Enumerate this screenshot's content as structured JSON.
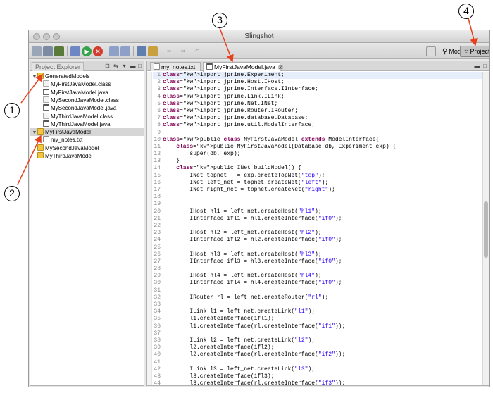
{
  "window": {
    "title": "Slingshot"
  },
  "perspectives": [
    {
      "label": "Model",
      "active": false
    },
    {
      "label": "Project",
      "active": true
    }
  ],
  "explorer": {
    "tab_label": "Project Explorer",
    "tree": [
      {
        "label": "GeneratedModels",
        "icon": "folder-icon",
        "expanded": true,
        "indent": 0
      },
      {
        "label": "MyFirstJavaModel.class",
        "icon": "class-file-icon",
        "indent": 1
      },
      {
        "label": "MyFirstJavaModel.java",
        "icon": "java-file-icon",
        "indent": 1
      },
      {
        "label": "MySecondJavaModel.class",
        "icon": "class-file-icon",
        "indent": 1
      },
      {
        "label": "MySecondJavaModel.java",
        "icon": "java-file-icon",
        "indent": 1
      },
      {
        "label": "MyThirdJavaModel.class",
        "icon": "class-file-icon",
        "indent": 1
      },
      {
        "label": "MyThirdJavaModel.java",
        "icon": "java-file-icon",
        "indent": 1
      },
      {
        "label": "MyFirstJavaModel",
        "icon": "folder-icon",
        "expanded": true,
        "indent": 0,
        "selected": true
      },
      {
        "label": "my_notes.txt",
        "icon": "text-file-icon",
        "indent": 1
      },
      {
        "label": "MySecondJavaModel",
        "icon": "folder-icon",
        "indent": 0
      },
      {
        "label": "MyThirdJavaModel",
        "icon": "folder-icon",
        "indent": 0
      }
    ]
  },
  "editor": {
    "tabs": [
      {
        "label": "my_notes.txt",
        "active": false
      },
      {
        "label": "MyFirstJavaModel.java",
        "active": true
      }
    ],
    "lines": [
      {
        "n": "1",
        "text": "import jprime.Experiment;"
      },
      {
        "n": "2",
        "text": "import jprime.Host.IHost;"
      },
      {
        "n": "3",
        "text": "import jprime.Interface.IInterface;"
      },
      {
        "n": "4",
        "text": "import jprime.Link.ILink;"
      },
      {
        "n": "5",
        "text": "import jprime.Net.INet;"
      },
      {
        "n": "6",
        "text": "import jprime.Router.IRouter;"
      },
      {
        "n": "7",
        "text": "import jprime.database.Database;"
      },
      {
        "n": "8",
        "text": "import jprime.util.ModelInterface;"
      },
      {
        "n": "9",
        "text": ""
      },
      {
        "n": "10",
        "text": "public class MyFirstJavaModel extends ModelInterface{"
      },
      {
        "n": "11",
        "text": "    public MyFirstJavaModel(Database db, Experiment exp) {"
      },
      {
        "n": "12",
        "text": "        super(db, exp);"
      },
      {
        "n": "13",
        "text": "    }"
      },
      {
        "n": "14",
        "text": "    public INet buildModel() {"
      },
      {
        "n": "15",
        "text": "        INet topnet   = exp.createTopNet(\"top\");"
      },
      {
        "n": "16",
        "text": "        INet left_net = topnet.createNet(\"left\");"
      },
      {
        "n": "17",
        "text": "        INet right_net = topnet.createNet(\"right\");"
      },
      {
        "n": "18",
        "text": ""
      },
      {
        "n": "19",
        "text": ""
      },
      {
        "n": "20",
        "text": "        IHost hl1 = left_net.createHost(\"hl1\");"
      },
      {
        "n": "21",
        "text": "        IInterface ifl1 = hl1.createInterface(\"if0\");"
      },
      {
        "n": "22",
        "text": ""
      },
      {
        "n": "23",
        "text": "        IHost hl2 = left_net.createHost(\"hl2\");"
      },
      {
        "n": "24",
        "text": "        IInterface ifl2 = hl2.createInterface(\"if0\");"
      },
      {
        "n": "25",
        "text": ""
      },
      {
        "n": "26",
        "text": "        IHost hl3 = left_net.createHost(\"hl3\");"
      },
      {
        "n": "27",
        "text": "        IInterface ifl3 = hl3.createInterface(\"if0\");"
      },
      {
        "n": "28",
        "text": ""
      },
      {
        "n": "29",
        "text": "        IHost hl4 = left_net.createHost(\"hl4\");"
      },
      {
        "n": "30",
        "text": "        IInterface ifl4 = hl4.createInterface(\"if0\");"
      },
      {
        "n": "31",
        "text": ""
      },
      {
        "n": "32",
        "text": "        IRouter rl = left_net.createRouter(\"rl\");"
      },
      {
        "n": "33",
        "text": ""
      },
      {
        "n": "34",
        "text": "        ILink l1 = left_net.createLink(\"l1\");"
      },
      {
        "n": "35",
        "text": "        l1.createInterface(ifl1);"
      },
      {
        "n": "36",
        "text": "        l1.createInterface(rl.createInterface(\"if1\"));"
      },
      {
        "n": "37",
        "text": ""
      },
      {
        "n": "38",
        "text": "        ILink l2 = left_net.createLink(\"l2\");"
      },
      {
        "n": "39",
        "text": "        l2.createInterface(ifl2);"
      },
      {
        "n": "40",
        "text": "        l2.createInterface(rl.createInterface(\"if2\"));"
      },
      {
        "n": "41",
        "text": ""
      },
      {
        "n": "42",
        "text": "        ILink l3 = left_net.createLink(\"l3\");"
      },
      {
        "n": "43",
        "text": "        l3.createInterface(ifl3);"
      },
      {
        "n": "44",
        "text": "        l3.createInterface(rl.createInterface(\"if3\"));"
      }
    ]
  },
  "callouts": [
    {
      "label": "1"
    },
    {
      "label": "2"
    },
    {
      "label": "3"
    },
    {
      "label": "4"
    }
  ],
  "colors": {
    "keyword": "#7f0055",
    "string": "#2a00ff",
    "arrow": "#e8401c",
    "selection": "#d6d6d6"
  }
}
